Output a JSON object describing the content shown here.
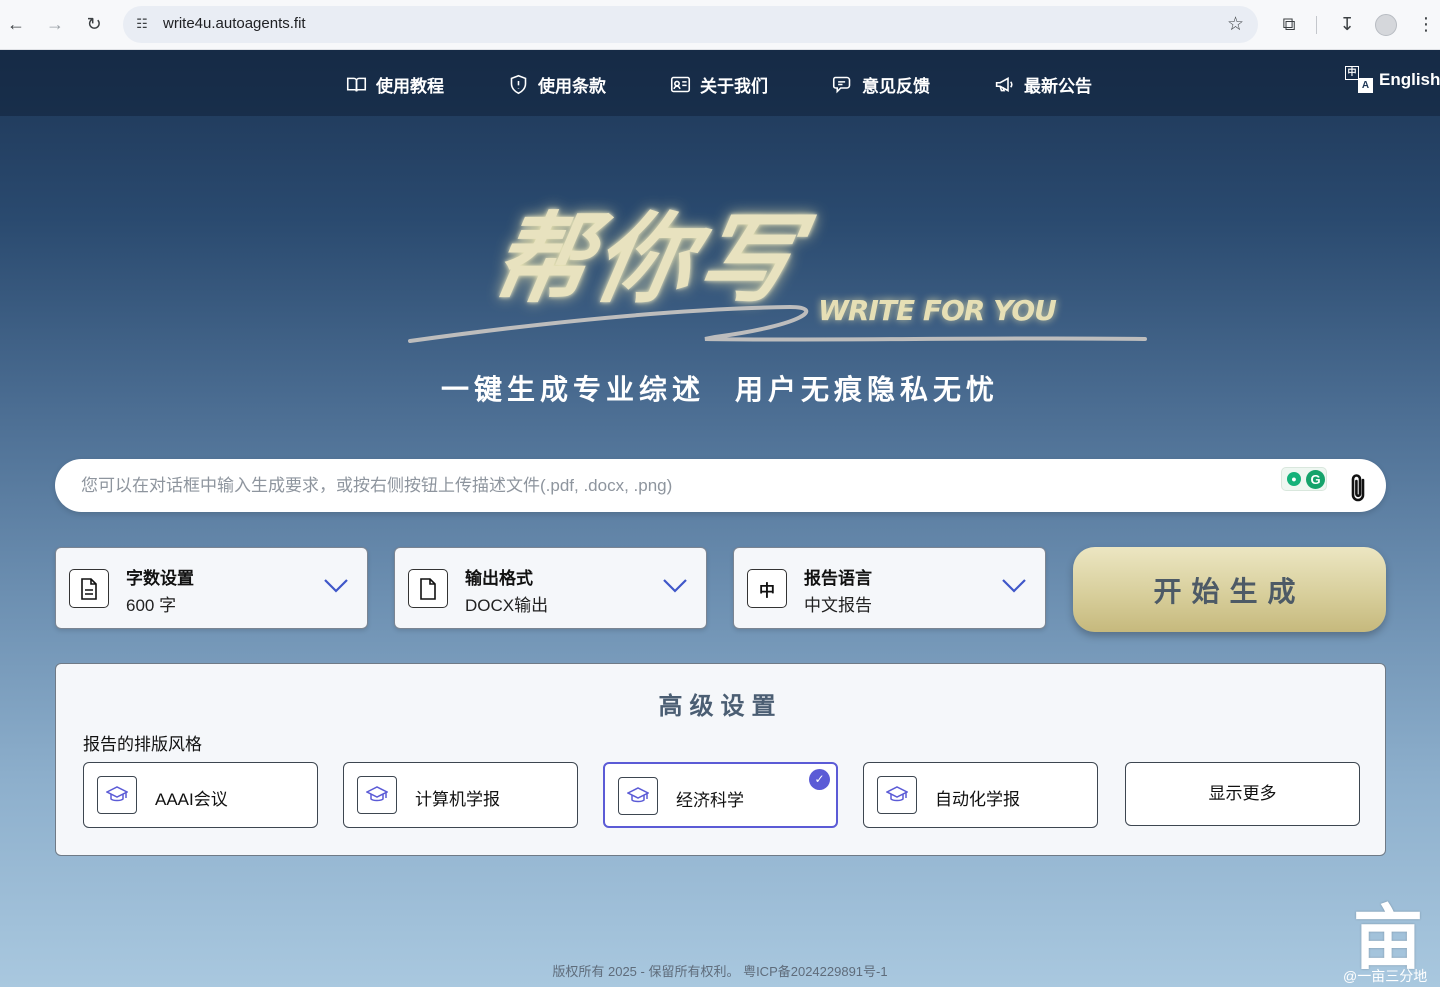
{
  "browser": {
    "url": "write4u.autoagents.fit"
  },
  "nav": {
    "items": [
      {
        "label": "使用教程",
        "icon": "book-icon"
      },
      {
        "label": "使用条款",
        "icon": "shield-icon"
      },
      {
        "label": "关于我们",
        "icon": "id-card-icon"
      },
      {
        "label": "意见反馈",
        "icon": "chat-icon"
      },
      {
        "label": "最新公告",
        "icon": "megaphone-icon"
      }
    ],
    "language": "English"
  },
  "hero": {
    "title": "帮你写",
    "subtitle_en": "WRITE FOR YOU",
    "slogan_left": "一键生成专业综述",
    "slogan_right": "用户无痕隐私无忧"
  },
  "prompt": {
    "placeholder": "您可以在对话框中输入生成要求，或按右侧按钮上传描述文件(.pdf, .docx, .png)",
    "value": ""
  },
  "selectors": {
    "word_count": {
      "title": "字数设置",
      "value": "600 字"
    },
    "output_format": {
      "title": "输出格式",
      "value": "DOCX输出"
    },
    "report_language": {
      "title": "报告语言",
      "value": "中文报告",
      "icon_text": "中"
    }
  },
  "start_button": "开始生成",
  "advanced": {
    "title": "高级设置",
    "layout_label": "报告的排版风格",
    "styles": [
      {
        "label": "AAAI会议",
        "selected": false
      },
      {
        "label": "计算机学报",
        "selected": false
      },
      {
        "label": "经济科学",
        "selected": true
      },
      {
        "label": "自动化学报",
        "selected": false
      }
    ],
    "show_more": "显示更多"
  },
  "footer": "版权所有 2025 - 保留所有权利。 粤ICP备2024229891号-1",
  "watermark": {
    "glyph": "亩",
    "text": "@一亩三分地"
  },
  "colors": {
    "accent": "#5b5bd6",
    "gold": "#d8cf9c",
    "page_top": "#1d3555",
    "page_bottom": "#a9c8df"
  }
}
